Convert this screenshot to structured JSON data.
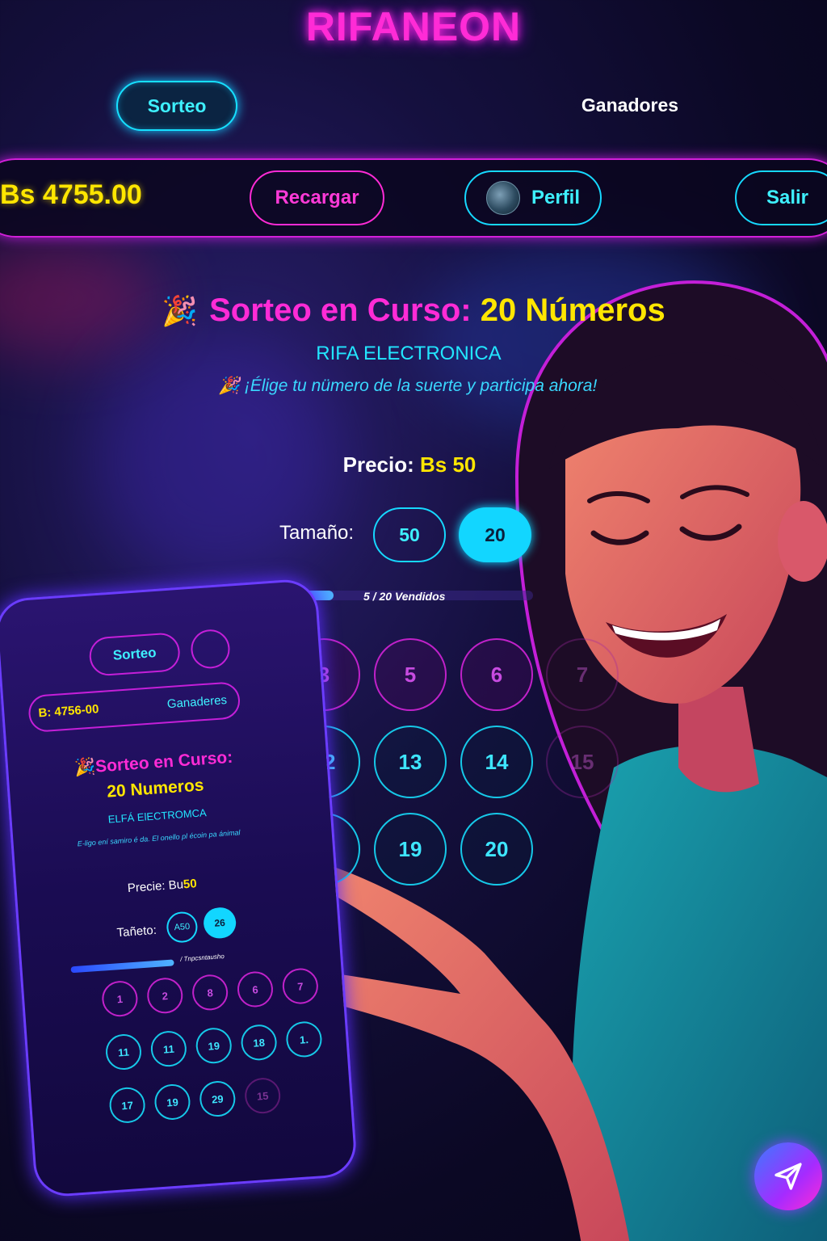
{
  "app": {
    "brand": "RIFANEON"
  },
  "nav": {
    "sorteo": "Sorteo",
    "ganadores": "Ganadores"
  },
  "topbar": {
    "balance": "Bs 4755.00",
    "recargar": "Recargar",
    "perfil": "Perfil",
    "salir": "Salir"
  },
  "raffle": {
    "title_prefix": "Sorteo en Curso:",
    "title_count": "20 Números",
    "subtitle": "RIFA ELECTRONICA",
    "tagline": "¡Élige tu nümero de la suerte y participa ahora!",
    "price_label": "Precio:",
    "price_value": "Bs 50",
    "size_label": "Tamaño:",
    "size_options": [
      "50",
      "20"
    ],
    "selected_size": "20",
    "progress_text": "5 / 20 Vendidos",
    "sold": 5,
    "total": 20,
    "numbers": [
      {
        "n": "3",
        "style": "magenta"
      },
      {
        "n": "5",
        "style": "magenta"
      },
      {
        "n": "6",
        "style": "magenta"
      },
      {
        "n": "7",
        "style": "faded"
      },
      {
        "n": "12",
        "style": "cyan"
      },
      {
        "n": "13",
        "style": "cyan"
      },
      {
        "n": "14",
        "style": "cyan"
      },
      {
        "n": "15",
        "style": "faded"
      },
      {
        "n": "19",
        "style": "cyan"
      },
      {
        "n": "20",
        "style": "cyan"
      }
    ]
  },
  "phone": {
    "sorteo": "Sorteo",
    "balance": "B: 4756-00",
    "ganadores": "Ganaderes",
    "title_prefix": "Sorteo en Curso:",
    "title_count": "20 Numeros",
    "subtitle": "ELFÁ ElECTROMCA",
    "tagline": "E-ligo ení samiro é da. El onello pl écoin pa ánimal",
    "price_label": "Precie: Bu",
    "price_value": "50",
    "size_label": "Tañeto:",
    "size_options": [
      "A50",
      "26"
    ],
    "progress_text": "/ Tnpcsntausho",
    "numbers": [
      {
        "n": "1",
        "style": "m"
      },
      {
        "n": "2",
        "style": "m"
      },
      {
        "n": "8",
        "style": "m"
      },
      {
        "n": "6",
        "style": "m"
      },
      {
        "n": "7",
        "style": "m"
      },
      {
        "n": "11",
        "style": "c"
      },
      {
        "n": "11",
        "style": "c"
      },
      {
        "n": "19",
        "style": "c"
      },
      {
        "n": "18",
        "style": "c"
      },
      {
        "n": "1.",
        "style": "c"
      },
      {
        "n": "17",
        "style": "c"
      },
      {
        "n": "19",
        "style": "c"
      },
      {
        "n": "29",
        "style": "c"
      },
      {
        "n": "15",
        "style": "f"
      }
    ]
  },
  "icons": {
    "party": "party-popper-icon",
    "send": "paper-plane-icon",
    "avatar": "profile-avatar"
  },
  "colors": {
    "magenta": "#ff2bd6",
    "cyan": "#16d8ff",
    "yellow": "#ffe600",
    "background": "#0b0824"
  }
}
